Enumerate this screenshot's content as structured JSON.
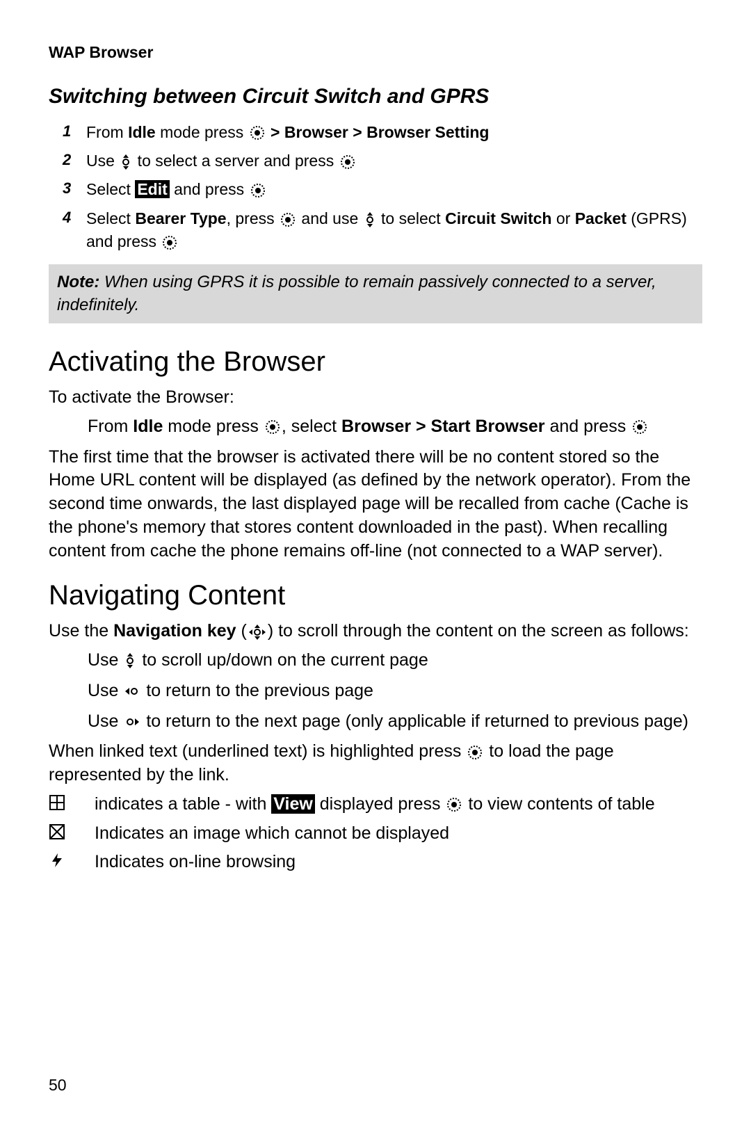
{
  "header": "WAP Browser",
  "switching": {
    "heading": "Switching between Circuit Switch and GPRS",
    "steps": {
      "s1_a": "From ",
      "s1_b": "Idle",
      "s1_c": " mode press ",
      "s1_d": " > Browser > Browser Setting",
      "s2_a": "Use ",
      "s2_b": " to select a server and press ",
      "s3_a": "Select ",
      "s3_b": "Edit",
      "s3_c": " and press ",
      "s4_a": "Select ",
      "s4_b": "Bearer Type",
      "s4_c": ", press ",
      "s4_d": " and use ",
      "s4_e": " to select ",
      "s4_f": "Circuit Switch",
      "s4_g": " or ",
      "s4_h": "Packet",
      "s4_i": " (GPRS) and press "
    },
    "note_label": "Note:",
    "note_text": " When using GPRS it is possible to remain passively connected to a server, indefinitely."
  },
  "activating": {
    "heading": "Activating the Browser",
    "intro": "To activate the Browser:",
    "line_a": "From ",
    "line_b": "Idle",
    "line_c": " mode press ",
    "line_d": ", select ",
    "line_e": "Browser > Start Browser",
    "line_f": " and press ",
    "para": "The first time that the browser is activated there will be no content stored so the Home URL content will be displayed (as defined by the network operator). From the second time onwards, the last displayed page will be recalled from cache (Cache is the phone's memory that stores content downloaded in the past). When recalling content from cache the phone remains off-line (not connected to a WAP server)."
  },
  "navigating": {
    "heading": "Navigating Content",
    "intro_a": "Use the ",
    "intro_b": "Navigation key",
    "intro_c": " (",
    "intro_d": ") to scroll through the content on the screen as follows:",
    "b1_a": "Use ",
    "b1_b": " to scroll up/down on the current page",
    "b2_a": "Use ",
    "b2_b": " to return to the previous page",
    "b3_a": "Use ",
    "b3_b": " to return to the next page (only applicable if returned to previous page)",
    "linked_a": "When linked text (underlined text) is highlighted press ",
    "linked_b": " to load the page represented by the link.",
    "t1_a": "indicates a table - with ",
    "t1_b": "View",
    "t1_c": " displayed press ",
    "t1_d": " to view contents of table",
    "t2": "Indicates an image which cannot be displayed",
    "t3": "Indicates on-line browsing"
  },
  "page_number": "50"
}
